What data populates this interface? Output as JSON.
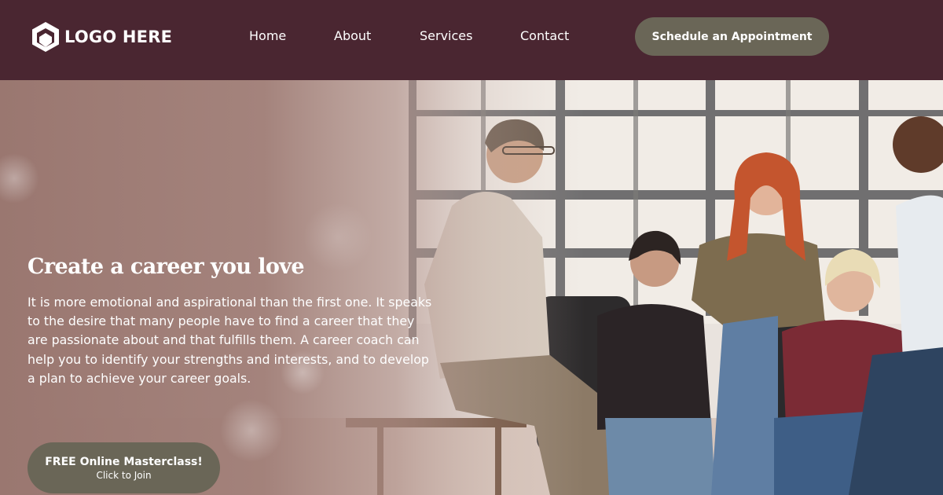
{
  "header": {
    "logo_text": "LOGO HERE",
    "nav": [
      {
        "label": "Home"
      },
      {
        "label": "About"
      },
      {
        "label": "Services"
      },
      {
        "label": "Contact"
      }
    ],
    "cta_label": "Schedule an Appointment"
  },
  "hero": {
    "title": "Create a career you love",
    "body": "It is more emotional and aspirational than the first one. It speaks to the desire that many people have to find a career that they are passionate about and that fulfills them. A career coach can help you to identify your strengths and interests, and to develop a plan to achieve your career goals.",
    "button": {
      "title": "FREE Online Masterclass!",
      "subtitle": "Click to Join"
    },
    "image_description_icon": "group-meeting-photo"
  },
  "colors": {
    "header_bg": "#4a2631",
    "button_bg": "#6a6657",
    "overlay": "#9a7770",
    "text": "#ffffff"
  }
}
